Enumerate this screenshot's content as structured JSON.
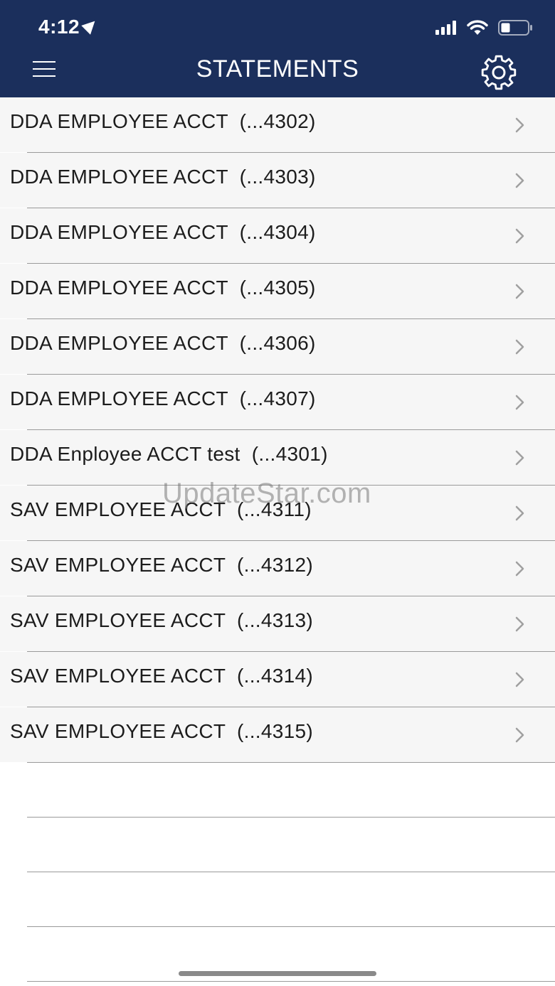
{
  "status_bar": {
    "time": "4:12",
    "icons": [
      "location-arrow-icon",
      "cellular-signal-icon",
      "wifi-icon",
      "battery-icon"
    ]
  },
  "header": {
    "title": "STATEMENTS",
    "menu_icon": "hamburger-menu-icon",
    "settings_icon": "gear-icon",
    "background_color": "#1b2f5c"
  },
  "accounts": [
    {
      "name": "DDA EMPLOYEE ACCT",
      "number": "(...4302)"
    },
    {
      "name": "DDA EMPLOYEE ACCT",
      "number": "(...4303)"
    },
    {
      "name": "DDA EMPLOYEE ACCT",
      "number": "(...4304)"
    },
    {
      "name": "DDA EMPLOYEE ACCT",
      "number": "(...4305)"
    },
    {
      "name": "DDA EMPLOYEE ACCT",
      "number": "(...4306)"
    },
    {
      "name": "DDA EMPLOYEE ACCT",
      "number": "(...4307)"
    },
    {
      "name": "DDA Enployee ACCT test",
      "number": "(...4301)"
    },
    {
      "name": "SAV EMPLOYEE ACCT",
      "number": "(...4311)"
    },
    {
      "name": "SAV EMPLOYEE ACCT",
      "number": "(...4312)"
    },
    {
      "name": "SAV EMPLOYEE ACCT",
      "number": "(...4313)"
    },
    {
      "name": "SAV EMPLOYEE ACCT",
      "number": "(...4314)"
    },
    {
      "name": "SAV EMPLOYEE ACCT",
      "number": "(...4315)"
    }
  ],
  "watermark": "UpdateStar.com"
}
